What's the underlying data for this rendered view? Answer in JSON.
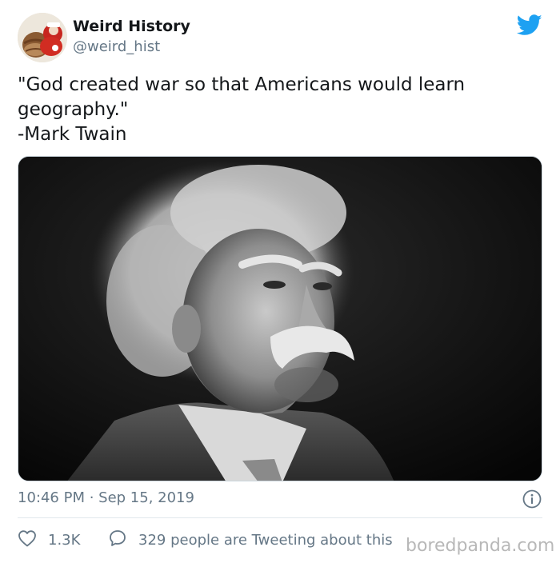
{
  "tweet": {
    "author_name": "Weird History",
    "author_handle": "@weird_hist",
    "text_lines": [
      "\"God created war so that Americans would learn",
      "geography.\"",
      "-Mark Twain"
    ],
    "timestamp": "10:46 PM · Sep 15, 2019",
    "likes": "1.3K",
    "reply_text": "329 people are Tweeting about this"
  },
  "watermark": "boredpanda.com",
  "icons": {
    "platform": "twitter-bird-icon",
    "info": "info-icon",
    "like": "heart-icon",
    "reply": "speech-bubble-icon"
  },
  "colors": {
    "brand": "#1da1f2",
    "secondary_text": "#657786",
    "primary_text": "#14171a"
  }
}
